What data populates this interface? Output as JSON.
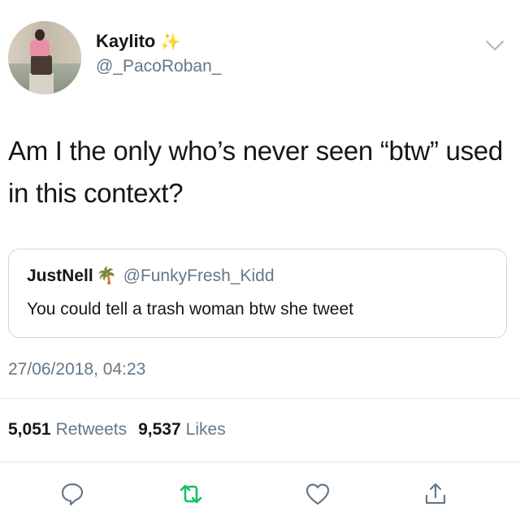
{
  "author": {
    "display_name": "Kaylito",
    "handle": "@_PacoRoban_",
    "name_emoji": "sparkles-icon"
  },
  "tweet": {
    "text": "Am I the only who’s never seen “btw” used in this context?",
    "timestamp": "27/06/2018, 04:23"
  },
  "quoted_tweet": {
    "display_name": "JustNell",
    "name_emoji": "palm-tree-icon",
    "handle": "@FunkyFresh_Kidd",
    "text": "You could tell a trash woman btw she tweet"
  },
  "stats": {
    "retweets_count": "5,051",
    "retweets_label": "Retweets",
    "likes_count": "9,537",
    "likes_label": "Likes"
  },
  "actions": [
    "reply-icon",
    "retweet-icon",
    "like-icon",
    "share-icon"
  ],
  "colors": {
    "text_primary": "#14171a",
    "text_secondary": "#657786",
    "border": "#ccd6dd",
    "retweet_green": "#17bf63",
    "icon_gray": "#1da1f2"
  }
}
